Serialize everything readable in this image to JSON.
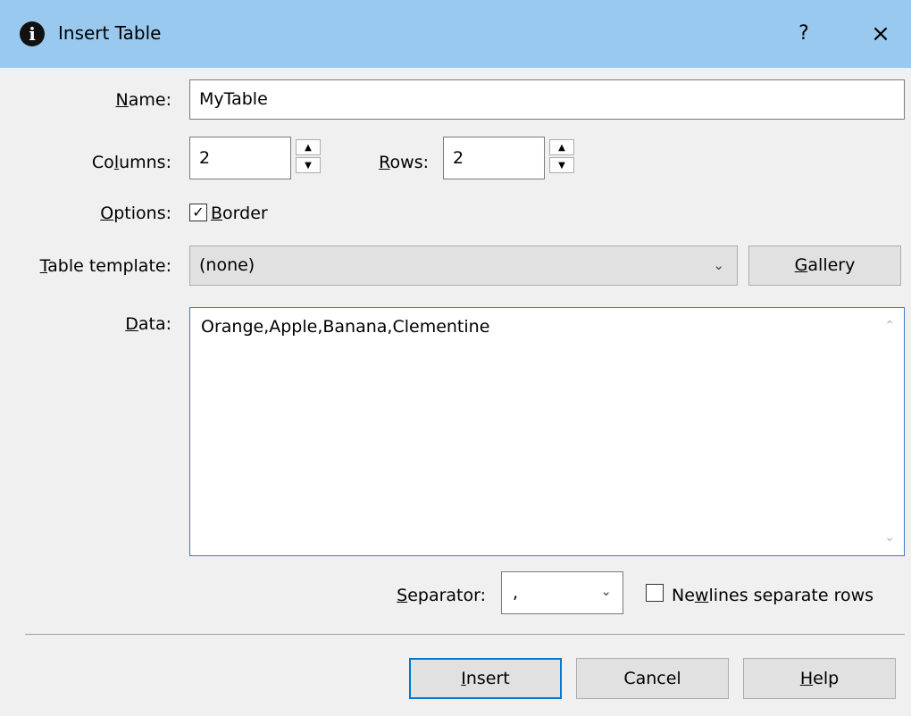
{
  "window": {
    "title": "Insert Table",
    "help_label": "?",
    "close_label": "×"
  },
  "name": {
    "label_pre": "",
    "label_key": "N",
    "label_post": "ame:",
    "value": "MyTable"
  },
  "columns": {
    "label_pre": "Co",
    "label_key": "l",
    "label_post": "umns:",
    "value": "2"
  },
  "rows": {
    "label_pre": "",
    "label_key": "R",
    "label_post": "ows:",
    "value": "2"
  },
  "options": {
    "label_pre": "",
    "label_key": "O",
    "label_post": "ptions:",
    "border_checked": true,
    "border_pre": "",
    "border_key": "B",
    "border_post": "order"
  },
  "table_template": {
    "label_pre": "",
    "label_key": "T",
    "label_post": "able template:",
    "value": "(none)",
    "gallery_pre": "",
    "gallery_key": "G",
    "gallery_post": "allery"
  },
  "data": {
    "label_pre": "",
    "label_key": "D",
    "label_post": "ata:",
    "value": "Orange,Apple,Banana,Clementine"
  },
  "separator": {
    "label_pre": "",
    "label_key": "S",
    "label_post": "eparator:",
    "value": ","
  },
  "newlines": {
    "checked": false,
    "label_pre": "Ne",
    "label_key": "w",
    "label_post": "lines separate rows"
  },
  "buttons": {
    "insert_pre": "",
    "insert_key": "I",
    "insert_post": "nsert",
    "cancel": "Cancel",
    "help_pre": "",
    "help_key": "H",
    "help_post": "elp"
  },
  "icons": {
    "spin_up": "▲",
    "spin_down": "▼",
    "check": "✓",
    "chevron": "⌄",
    "scroll_up": "⌃",
    "scroll_down": "⌄"
  }
}
